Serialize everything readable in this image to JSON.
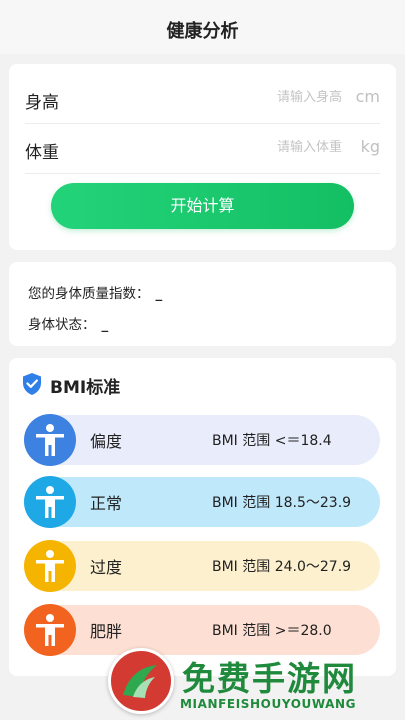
{
  "header": {
    "title": "健康分析"
  },
  "form": {
    "height": {
      "label": "身高",
      "placeholder": "请输入身高",
      "value": "",
      "unit": "cm"
    },
    "weight": {
      "label": "体重",
      "placeholder": "请输入体重",
      "value": "",
      "unit": "kg"
    },
    "calculate_label": "开始计算"
  },
  "result": {
    "bmi_label": "您的身体质量指数：",
    "bmi_value": "_",
    "status_label": "身体状态：",
    "status_value": "_"
  },
  "standard": {
    "title": "BMI标准",
    "icon": "shield-check-icon",
    "rows": [
      {
        "name": "偏度",
        "range": "BMI 范围 <＝18.4",
        "icon": "person-icon",
        "color": "#3d82e0",
        "bg": "#e9edfb"
      },
      {
        "name": "正常",
        "range": "BMI 范围 18.5～23.9",
        "icon": "person-icon",
        "color": "#1fa8e6",
        "bg": "#bfe8fb"
      },
      {
        "name": "过度",
        "range": "BMI 范围 24.0～27.9",
        "icon": "person-icon",
        "color": "#f5b400",
        "bg": "#fdf0cf"
      },
      {
        "name": "肥胖",
        "range": "BMI 范围 >＝28.0",
        "icon": "person-icon",
        "color": "#f2631f",
        "bg": "#fde0d3"
      }
    ]
  },
  "watermark": {
    "brand": "免费手游网",
    "domain": "MIANFEISHOUYOUWANG",
    "colors": {
      "brand": "#1f8a3c",
      "logo": "#d33a32"
    }
  }
}
